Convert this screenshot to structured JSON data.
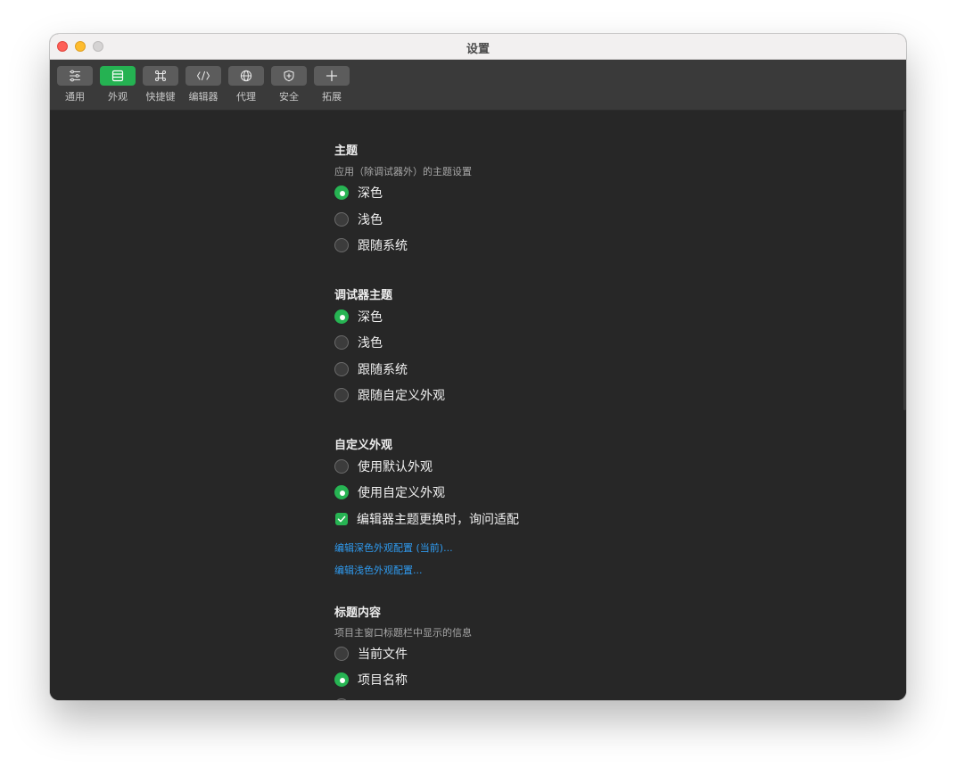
{
  "window": {
    "title": "设置"
  },
  "toolbar": {
    "items": [
      {
        "label": "通用",
        "icon": "sliders-icon",
        "active": false
      },
      {
        "label": "外观",
        "icon": "window-layout-icon",
        "active": true
      },
      {
        "label": "快捷键",
        "icon": "command-key-icon",
        "active": false
      },
      {
        "label": "编辑器",
        "icon": "code-brackets-icon",
        "active": false
      },
      {
        "label": "代理",
        "icon": "globe-icon",
        "active": false
      },
      {
        "label": "安全",
        "icon": "shield-icon",
        "active": false
      },
      {
        "label": "拓展",
        "icon": "plus-icon",
        "active": false
      }
    ]
  },
  "colors": {
    "accent": "#27b453",
    "link": "#2f9bf0",
    "background": "#272727",
    "toolbar": "#3a3a3a"
  },
  "sections": {
    "theme": {
      "title": "主题",
      "description": "应用（除调试器外）的主题设置",
      "options": [
        {
          "label": "深色",
          "selected": true
        },
        {
          "label": "浅色",
          "selected": false
        },
        {
          "label": "跟随系统",
          "selected": false
        }
      ]
    },
    "debugger_theme": {
      "title": "调试器主题",
      "options": [
        {
          "label": "深色",
          "selected": true
        },
        {
          "label": "浅色",
          "selected": false
        },
        {
          "label": "跟随系统",
          "selected": false
        },
        {
          "label": "跟随自定义外观",
          "selected": false
        }
      ]
    },
    "custom_appearance": {
      "title": "自定义外观",
      "options": [
        {
          "label": "使用默认外观",
          "selected": false
        },
        {
          "label": "使用自定义外观",
          "selected": true
        }
      ],
      "checkbox": {
        "label": "编辑器主题更换时，询问适配",
        "checked": true
      },
      "links": [
        "编辑深色外观配置 (当前)...",
        "编辑浅色外观配置..."
      ]
    },
    "title_content": {
      "title": "标题内容",
      "description": "项目主窗口标题栏中显示的信息",
      "options": [
        {
          "label": "当前文件",
          "selected": false
        },
        {
          "label": "项目名称",
          "selected": true
        }
      ]
    }
  }
}
